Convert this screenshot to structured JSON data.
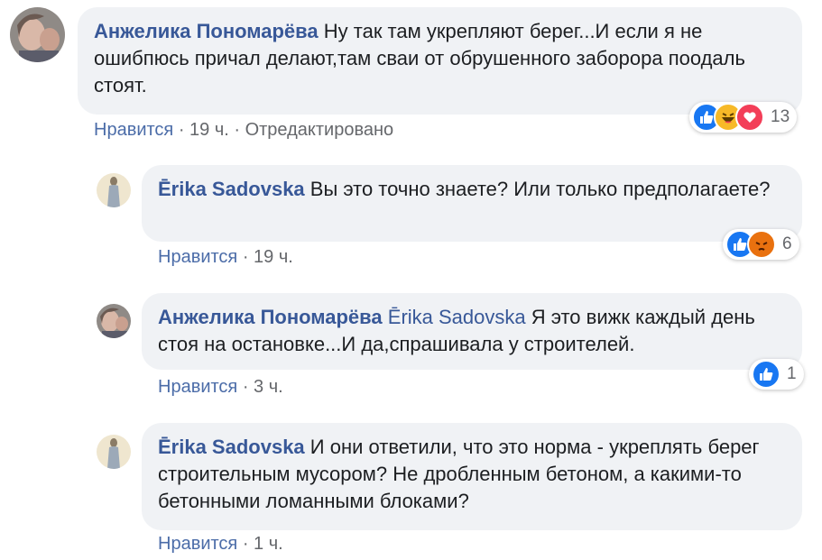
{
  "comments": [
    {
      "author": "Анжелика Пономарёва",
      "mention": "",
      "text": " Ну так там укрепляют берег...И если я не ошибпюсь причал делают,там сваи от обрушенного забороpa поодаль стоят.",
      "like": "Нравится",
      "time": " · 19 ч. · ",
      "edited": "Отредактировано",
      "reaction_icons": [
        "like-reaction-icon",
        "haha-reaction-icon",
        "love-reaction-icon"
      ],
      "reaction_count": "13"
    },
    {
      "author": "Ērika Sadovska",
      "mention": "",
      "text": " Вы это точно знаете? Или только предполагаете?",
      "like": "Нравится",
      "time": " · 19 ч.",
      "reaction_icons": [
        "like-reaction-icon",
        "angry-reaction-icon"
      ],
      "reaction_count": "6"
    },
    {
      "author": "Анжелика Пономарёва",
      "mention": "Ērika Sadovska",
      "text": " Я это вижк каждый день стоя на остановке...И да,спрашивала у строителей.",
      "like": "Нравится",
      "time": " · 3 ч.",
      "reaction_icons": [
        "like-reaction-icon"
      ],
      "reaction_count": "1"
    },
    {
      "author": "Ērika Sadovska",
      "mention": "",
      "text": " И они ответили, что это норма - укреплять берег строительным мусором? Не дробленным бетоном, а какими-то бетонными ломанными блоками?",
      "like": "Нравится",
      "time": " · 1 ч."
    }
  ],
  "colors": {
    "link": "#385898",
    "bubble": "#f0f2f5",
    "meta": "#65676b",
    "like_blue": "#1877f2",
    "angry_orange": "#e9710f",
    "haha_yellow": "#f7b928",
    "love_red": "#f33e58"
  }
}
